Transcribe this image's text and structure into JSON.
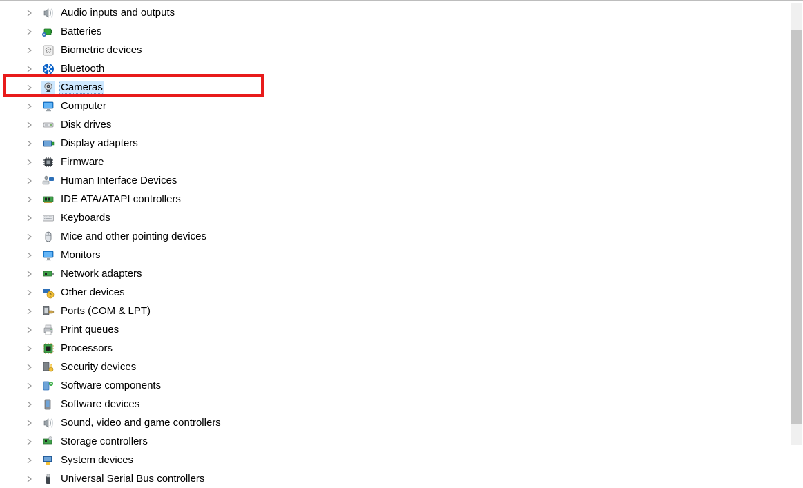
{
  "categories": [
    {
      "id": "audio",
      "label": "Audio inputs and outputs",
      "icon": "speaker-icon",
      "selected": false,
      "highlighted": false
    },
    {
      "id": "batteries",
      "label": "Batteries",
      "icon": "battery-icon",
      "selected": false,
      "highlighted": false
    },
    {
      "id": "biometric",
      "label": "Biometric devices",
      "icon": "fingerprint-icon",
      "selected": false,
      "highlighted": false
    },
    {
      "id": "bluetooth",
      "label": "Bluetooth",
      "icon": "bluetooth-icon",
      "selected": false,
      "highlighted": false
    },
    {
      "id": "cameras",
      "label": "Cameras",
      "icon": "camera-icon",
      "selected": true,
      "highlighted": true
    },
    {
      "id": "computer",
      "label": "Computer",
      "icon": "monitor-icon",
      "selected": false,
      "highlighted": false
    },
    {
      "id": "diskdrives",
      "label": "Disk drives",
      "icon": "drive-icon",
      "selected": false,
      "highlighted": false
    },
    {
      "id": "display",
      "label": "Display adapters",
      "icon": "display-adapter-icon",
      "selected": false,
      "highlighted": false
    },
    {
      "id": "firmware",
      "label": "Firmware",
      "icon": "chip-icon",
      "selected": false,
      "highlighted": false
    },
    {
      "id": "hid",
      "label": "Human Interface Devices",
      "icon": "hid-icon",
      "selected": false,
      "highlighted": false
    },
    {
      "id": "ide",
      "label": "IDE ATA/ATAPI controllers",
      "icon": "ide-icon",
      "selected": false,
      "highlighted": false
    },
    {
      "id": "keyboards",
      "label": "Keyboards",
      "icon": "keyboard-icon",
      "selected": false,
      "highlighted": false
    },
    {
      "id": "mice",
      "label": "Mice and other pointing devices",
      "icon": "mouse-icon",
      "selected": false,
      "highlighted": false
    },
    {
      "id": "monitors",
      "label": "Monitors",
      "icon": "monitor-icon",
      "selected": false,
      "highlighted": false
    },
    {
      "id": "network",
      "label": "Network adapters",
      "icon": "network-icon",
      "selected": false,
      "highlighted": false
    },
    {
      "id": "other",
      "label": "Other devices",
      "icon": "unknown-device-icon",
      "selected": false,
      "highlighted": false
    },
    {
      "id": "ports",
      "label": "Ports (COM & LPT)",
      "icon": "port-icon",
      "selected": false,
      "highlighted": false
    },
    {
      "id": "printq",
      "label": "Print queues",
      "icon": "printer-icon",
      "selected": false,
      "highlighted": false
    },
    {
      "id": "processors",
      "label": "Processors",
      "icon": "processor-icon",
      "selected": false,
      "highlighted": false
    },
    {
      "id": "security",
      "label": "Security devices",
      "icon": "security-icon",
      "selected": false,
      "highlighted": false
    },
    {
      "id": "swcomp",
      "label": "Software components",
      "icon": "software-component-icon",
      "selected": false,
      "highlighted": false
    },
    {
      "id": "swdev",
      "label": "Software devices",
      "icon": "software-device-icon",
      "selected": false,
      "highlighted": false
    },
    {
      "id": "sound",
      "label": "Sound, video and game controllers",
      "icon": "speaker-icon",
      "selected": false,
      "highlighted": false
    },
    {
      "id": "storage",
      "label": "Storage controllers",
      "icon": "storage-controller-icon",
      "selected": false,
      "highlighted": false
    },
    {
      "id": "system",
      "label": "System devices",
      "icon": "system-device-icon",
      "selected": false,
      "highlighted": false
    },
    {
      "id": "usb",
      "label": "Universal Serial Bus controllers",
      "icon": "usb-icon",
      "selected": false,
      "highlighted": false
    }
  ]
}
